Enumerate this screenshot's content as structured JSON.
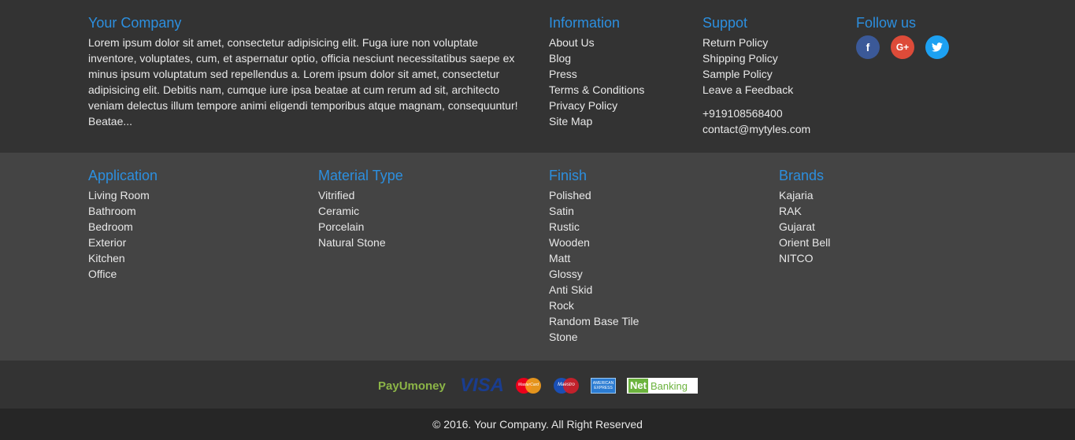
{
  "company": {
    "title": "Your Company",
    "description": "Lorem ipsum dolor sit amet, consectetur adipisicing elit. Fuga iure non voluptate inventore, voluptates, cum, et aspernatur optio, officia nesciunt necessitatibus saepe ex minus ipsum voluptatum sed repellendus a. Lorem ipsum dolor sit amet, consectetur adipisicing elit. Debitis nam, cumque iure ipsa beatae at cum rerum ad sit, architecto veniam delectus illum tempore animi eligendi temporibus atque magnam, consequuntur! Beatae..."
  },
  "information": {
    "title": "Information",
    "links": [
      "About Us",
      "Blog",
      "Press",
      "Terms & Conditions",
      "Privacy Policy",
      "Site Map"
    ]
  },
  "support": {
    "title": "Suppot",
    "links": [
      "Return Policy",
      "Shipping Policy",
      "Sample Policy",
      "Leave a Feedback"
    ],
    "phone": "+919108568400",
    "email": "contact@mytyles.com"
  },
  "follow": {
    "title": "Follow us",
    "icons": [
      {
        "name": "facebook-icon",
        "glyph": "f",
        "color": "#3b5998"
      },
      {
        "name": "google-plus-icon",
        "glyph": "G+",
        "color": "#dd4b39"
      },
      {
        "name": "twitter-icon",
        "glyph": "t",
        "color": "#1da1f2"
      }
    ]
  },
  "application": {
    "title": "Application",
    "links": [
      "Living Room",
      "Bathroom",
      "Bedroom",
      "Exterior",
      "Kitchen",
      "Office"
    ]
  },
  "material": {
    "title": "Material Type",
    "links": [
      "Vitrified",
      "Ceramic",
      "Porcelain",
      "Natural Stone"
    ]
  },
  "finish": {
    "title": "Finish",
    "links": [
      "Polished",
      "Satin",
      "Rustic",
      "Wooden",
      "Matt",
      "Glossy",
      "Anti Skid",
      "Rock",
      "Random Base Tile",
      "Stone"
    ]
  },
  "brands": {
    "title": "Brands",
    "links": [
      "Kajaria",
      "RAK",
      "Gujarat",
      "Orient Bell",
      "NITCO"
    ]
  },
  "payment": {
    "payumoney": "PayUmoney",
    "visa": "VISA",
    "mastercard": "MasterCard",
    "maestro": "Maestro",
    "amex": "AMERICAN EXPRESS",
    "net": "Net",
    "banking": "Banking"
  },
  "copyright": "© 2016. Your Company. All Right Reserved",
  "colors": {
    "accent": "#2c8fdf",
    "top_bg": "#333333",
    "middle_bg": "#444444",
    "bottom_bg": "#262626"
  }
}
